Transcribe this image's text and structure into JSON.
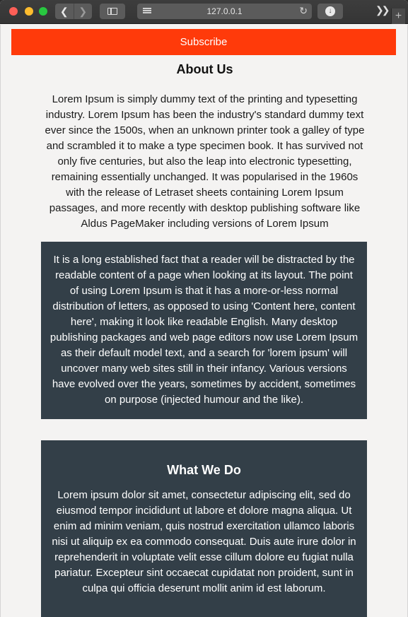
{
  "browser": {
    "url": "127.0.0.1",
    "icons": {
      "back": "chevron-left-icon",
      "forward": "chevron-right-icon",
      "sidebar": "sidebar-icon",
      "reader": "reader-icon",
      "reload": "reload-icon",
      "download": "download-icon",
      "more": "more-icon",
      "new_tab": "plus-icon"
    }
  },
  "page": {
    "subscribe_label": "Subscribe",
    "about": {
      "title": "About Us",
      "text": "Lorem Ipsum is simply dummy text of the printing and typesetting industry. Lorem Ipsum has been the industry's standard dummy text ever since the 1500s, when an unknown printer took a galley of type and scrambled it to make a type specimen book. It has survived not only five centuries, but also the leap into electronic typesetting, remaining essentially unchanged. It was popularised in the 1960s with the release of Letraset sheets containing Lorem Ipsum passages, and more recently with desktop publishing software like Aldus PageMaker including versions of Lorem Ipsum"
    },
    "fact_box": {
      "text": "It is a long established fact that a reader will be distracted by the readable content of a page when looking at its layout. The point of using Lorem Ipsum is that it has a more-or-less normal distribution of letters, as opposed to using 'Content here, content here', making it look like readable English. Many desktop publishing packages and web page editors now use Lorem Ipsum as their default model text, and a search for 'lorem ipsum' will uncover many web sites still in their infancy. Various versions have evolved over the years, sometimes by accident, sometimes on purpose (injected humour and the like)."
    },
    "what_we_do": {
      "title": "What We Do",
      "text": "Lorem ipsum dolor sit amet, consectetur adipiscing elit, sed do eiusmod tempor incididunt ut labore et dolore magna aliqua. Ut enim ad minim veniam, quis nostrud exercitation ullamco laboris nisi ut aliquip ex ea commodo consequat. Duis aute irure dolor in reprehenderit in voluptate velit esse cillum dolore eu fugiat nulla pariatur. Excepteur sint occaecat cupidatat non proident, sunt in culpa qui officia deserunt mollit anim id est laborum."
    },
    "colors": {
      "subscribe_bg": "#ff3a0a",
      "dark_box_bg": "#333f48",
      "page_bg": "#f4f3f2"
    }
  }
}
